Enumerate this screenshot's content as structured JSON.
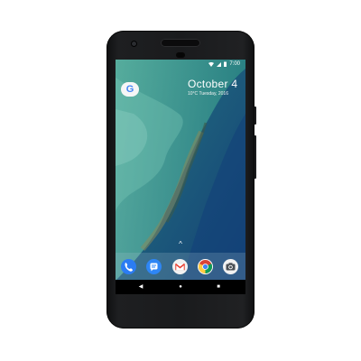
{
  "status_bar": {
    "time": "7:00"
  },
  "clock_widget": {
    "date": "October 4",
    "weather": "10°C  Tuesday, 2016"
  },
  "search": {
    "icon": "google-g-icon",
    "label": "G"
  },
  "dock": {
    "apps": [
      {
        "name": "Phone",
        "icon": "phone-icon"
      },
      {
        "name": "Messages",
        "icon": "messages-icon"
      },
      {
        "name": "Gmail",
        "icon": "gmail-icon"
      },
      {
        "name": "Chrome",
        "icon": "chrome-icon"
      },
      {
        "name": "Camera",
        "icon": "camera-icon"
      }
    ]
  },
  "nav": {
    "back": "◀",
    "home": "●",
    "recents": "■"
  },
  "colors": {
    "phone_body": "#1b1c1e",
    "sea_deep": "#15487a",
    "sea_shallow": "#2f9a8a",
    "accent_blue": "#4285f4",
    "accent_red": "#ea4335"
  }
}
